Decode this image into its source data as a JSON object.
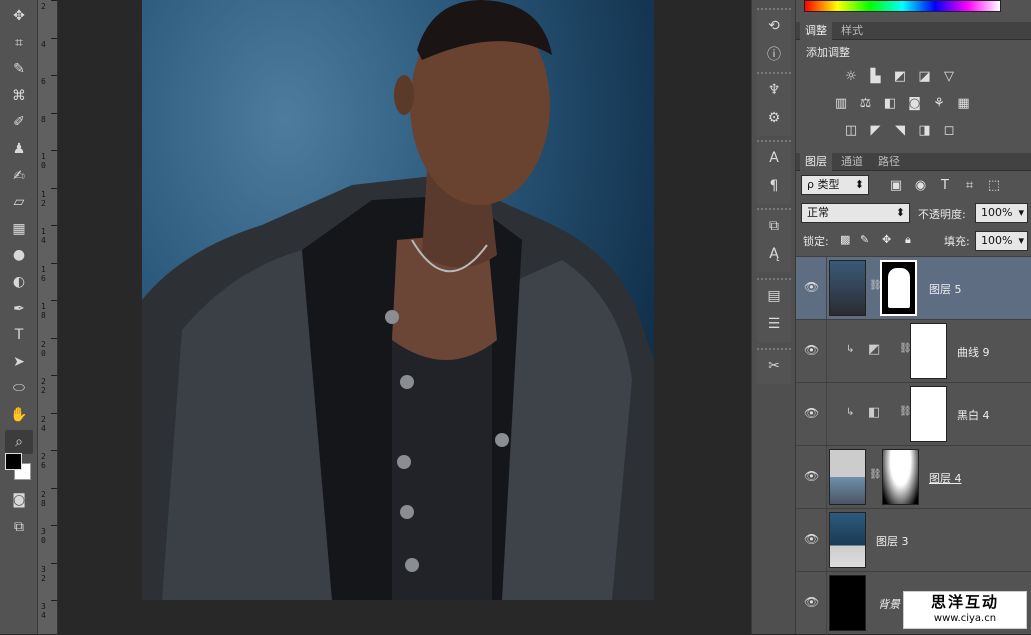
{
  "ruler": {
    "ticks": [
      "2",
      "4",
      "6",
      "8",
      "10",
      "12",
      "14",
      "16",
      "18",
      "20",
      "22",
      "24",
      "26",
      "28",
      "30",
      "32",
      "34"
    ]
  },
  "tools": [
    {
      "name": "move-tool-icon",
      "glyph": "✥"
    },
    {
      "name": "crop-tool-icon",
      "glyph": "⌗"
    },
    {
      "name": "eyedropper-tool-icon",
      "glyph": "✎"
    },
    {
      "name": "spot-healing-icon",
      "glyph": "⌘"
    },
    {
      "name": "brush-tool-icon",
      "glyph": "✐"
    },
    {
      "name": "clone-stamp-icon",
      "glyph": "♟"
    },
    {
      "name": "history-brush-icon",
      "glyph": "✍"
    },
    {
      "name": "eraser-tool-icon",
      "glyph": "▱"
    },
    {
      "name": "gradient-tool-icon",
      "glyph": "▦"
    },
    {
      "name": "blur-tool-icon",
      "glyph": "●"
    },
    {
      "name": "dodge-tool-icon",
      "glyph": "◐"
    },
    {
      "name": "pen-tool-icon",
      "glyph": "✒"
    },
    {
      "name": "type-tool-icon",
      "glyph": "T"
    },
    {
      "name": "path-selection-icon",
      "glyph": "➤"
    },
    {
      "name": "ellipse-tool-icon",
      "glyph": "⬭"
    },
    {
      "name": "hand-tool-icon",
      "glyph": "✋"
    },
    {
      "name": "zoom-tool-icon",
      "glyph": "⌕"
    }
  ],
  "dock": [
    {
      "name": "history-panel-icon",
      "glyph": "⟲"
    },
    {
      "name": "info-panel-icon",
      "glyph": "ⓘ"
    },
    {
      "name": "brush-presets-icon",
      "glyph": "♆"
    },
    {
      "name": "tool-presets-icon",
      "glyph": "⚙"
    },
    {
      "name": "character-panel-icon",
      "glyph": "A"
    },
    {
      "name": "paragraph-panel-icon",
      "glyph": "¶"
    },
    {
      "name": "clone-source-icon",
      "glyph": "⧉"
    },
    {
      "name": "character-styles-icon",
      "glyph": "Ą"
    },
    {
      "name": "notes-panel-icon",
      "glyph": "▤"
    },
    {
      "name": "paragraph-styles-icon",
      "glyph": "☰"
    },
    {
      "name": "tools-panel-icon",
      "glyph": "✂"
    }
  ],
  "adjust": {
    "tabs": [
      "调整",
      "样式"
    ],
    "header": "添加调整",
    "rows": [
      [
        "☼",
        "▙",
        "◩",
        "◪",
        "▽"
      ],
      [
        "▥",
        "⚖",
        "◧",
        "◙",
        "⚘",
        "▦"
      ],
      [
        "◫",
        "◤",
        "◥",
        "◨",
        "◻"
      ]
    ],
    "icon_names": [
      [
        "brightness-icon",
        "levels-icon",
        "curves-icon",
        "exposure-icon",
        "vibrance-icon"
      ],
      [
        "hue-saturation-icon",
        "color-balance-icon",
        "black-white-icon",
        "photo-filter-icon",
        "channel-mixer-icon",
        "color-lookup-icon"
      ],
      [
        "invert-icon",
        "posterize-icon",
        "threshold-icon",
        "selective-color-icon",
        "gradient-map-icon"
      ]
    ]
  },
  "layers_panel": {
    "tabs": [
      "图层",
      "通道",
      "路径"
    ],
    "filter_label": "ρ 类型",
    "filter_icons": [
      "▣",
      "◉",
      "T",
      "⌗",
      "⬚"
    ],
    "blend_mode": "正常",
    "opacity_label": "不透明度:",
    "opacity_value": "100%",
    "lock_label": "锁定:",
    "fill_label": "填充:",
    "fill_value": "100%"
  },
  "layers": [
    {
      "name": "图层 5",
      "selected": true
    },
    {
      "name": "曲线 9",
      "selected": false
    },
    {
      "name": "黑白 4",
      "selected": false
    },
    {
      "name": "图层 4",
      "selected": false
    },
    {
      "name": "图层 3",
      "selected": false
    },
    {
      "name": "背景",
      "selected": false
    }
  ],
  "watermark": {
    "title": "思洋互动",
    "url": "www.ciya.cn"
  },
  "colors": {
    "accent": "#5e6d82",
    "panel": "#535353"
  }
}
